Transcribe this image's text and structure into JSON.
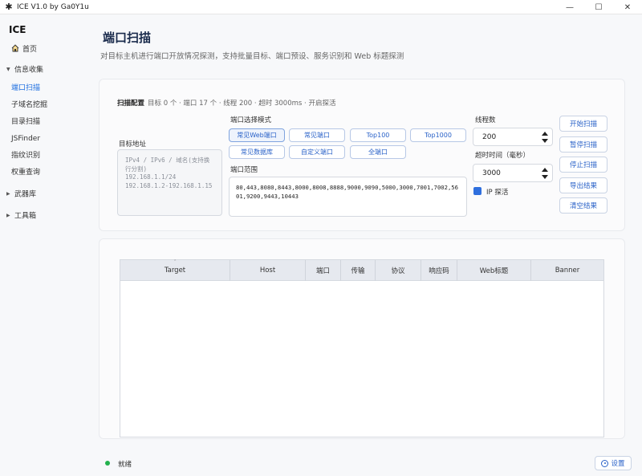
{
  "window": {
    "title": "ICE V1.0 by Ga0Y1u",
    "minimize_glyph": "—",
    "maximize_glyph": "☐",
    "close_glyph": "✕"
  },
  "sidebar": {
    "brand": "ICE",
    "home": "首页",
    "group_info": "信息收集",
    "items": [
      "端口扫描",
      "子域名挖掘",
      "目录扫描",
      "JSFinder",
      "指纹识别",
      "权重查询"
    ],
    "group_weapons": "武器库",
    "group_tools": "工具箱"
  },
  "page": {
    "title": "端口扫描",
    "description": "对目标主机进行端口开放情况探测，支持批量目标、端口预设、服务识别和 Web 标题探测"
  },
  "config": {
    "heading": "扫描配置",
    "summary": "目标 0 个 · 端口 17 个 · 线程 200 · 超时 3000ms · 开启探活",
    "target_label": "目标地址",
    "target_placeholder": "IPv4 / IPv6 / 域名(支持换行分割)\n192.168.1.1/24\n192.168.1.2-192.168.1.15",
    "mode_label": "端口选择模式",
    "modes": [
      "常见Web端口",
      "常见端口",
      "Top100",
      "Top1000",
      "常见数据库",
      "自定义端口",
      "全端口"
    ],
    "range_label": "端口范围",
    "range_value": "80,443,8080,8443,8000,8008,8888,9000,9090,5000,3000,7001,7002,5601,9200,9443,10443",
    "threads_label": "线程数",
    "threads_value": "200",
    "timeout_label": "超时时间（毫秒）",
    "timeout_value": "3000",
    "ip_alive_label": "IP 探活",
    "ip_alive_checked": true
  },
  "actions": {
    "start": "开始扫描",
    "pause": "暂停扫描",
    "stop": "停止扫描",
    "export": "导出结果",
    "clear": "清空结果"
  },
  "table": {
    "columns": [
      "Target",
      "Host",
      "端口",
      "传输",
      "协议",
      "响应码",
      "Web标题",
      "Banner"
    ],
    "sort_indicator": "⌃",
    "rows": []
  },
  "status": {
    "text": "就绪",
    "indicator_color": "#23b14d",
    "settings_label": "设置"
  },
  "colors": {
    "accent": "#2a62c8",
    "active_nav": "#1e6fe0",
    "checkbox": "#2f6fde"
  }
}
